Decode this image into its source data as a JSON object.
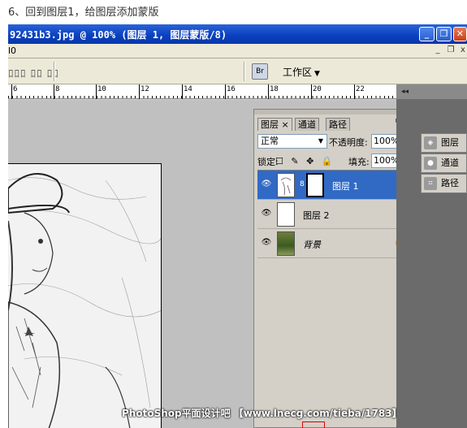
{
  "caption": "6、回到图层1，给图层添加蒙版",
  "window": {
    "title": "92431b3.jpg @ 100% (图层 1, 图层蒙版/8)",
    "minimize": "_",
    "restore": "❐",
    "close": "✕"
  },
  "docrow": {
    "left_label": "l0",
    "min": "_",
    "restore": "❐",
    "close": "x"
  },
  "optbar": {
    "distribute_icons": "ﾛﾛﾛ ﾛﾛ  ﾛﾛ",
    "bridge_icon": "Br",
    "workspace_label": "工作区",
    "workspace_arrow": "▼"
  },
  "ruler": {
    "labels": [
      "6",
      "8",
      "10",
      "12",
      "14",
      "16",
      "18",
      "20",
      "22"
    ]
  },
  "layers_panel": {
    "tabs": [
      "图层 ×",
      "通道",
      "路径"
    ],
    "menu_icon": "▸▸ ≡",
    "blend_mode": "正常",
    "opacity_label": "不透明度:",
    "opacity_value": "100%",
    "lock_label": "锁定:",
    "lock_icons": "☐ ✎ ✥ 🔒",
    "fill_label": "填充:",
    "fill_value": "100%",
    "layers": [
      {
        "name": "图层 1",
        "selected": true,
        "has_mask": true
      },
      {
        "name": "图层 2",
        "selected": false
      },
      {
        "name": "背景",
        "selected": false,
        "locked": true
      }
    ],
    "eye_icon": "👁",
    "lock_glyph": "🔒",
    "link_glyph": "8"
  },
  "dock": {
    "header": "◂◂",
    "items": [
      {
        "label": "图层",
        "icon": "◈"
      },
      {
        "label": "通道",
        "icon": "●"
      },
      {
        "label": "路径",
        "icon": "⌗"
      }
    ]
  },
  "watermark": "PhotoShop平面设计吧 【www.lnecg.com/tieba/1783】",
  "colors": {
    "title_bar": "#0a3fbf",
    "selection": "#316ac5",
    "canvas_bg": "#c0c0c0",
    "panel_bg": "#d4d0c8"
  }
}
